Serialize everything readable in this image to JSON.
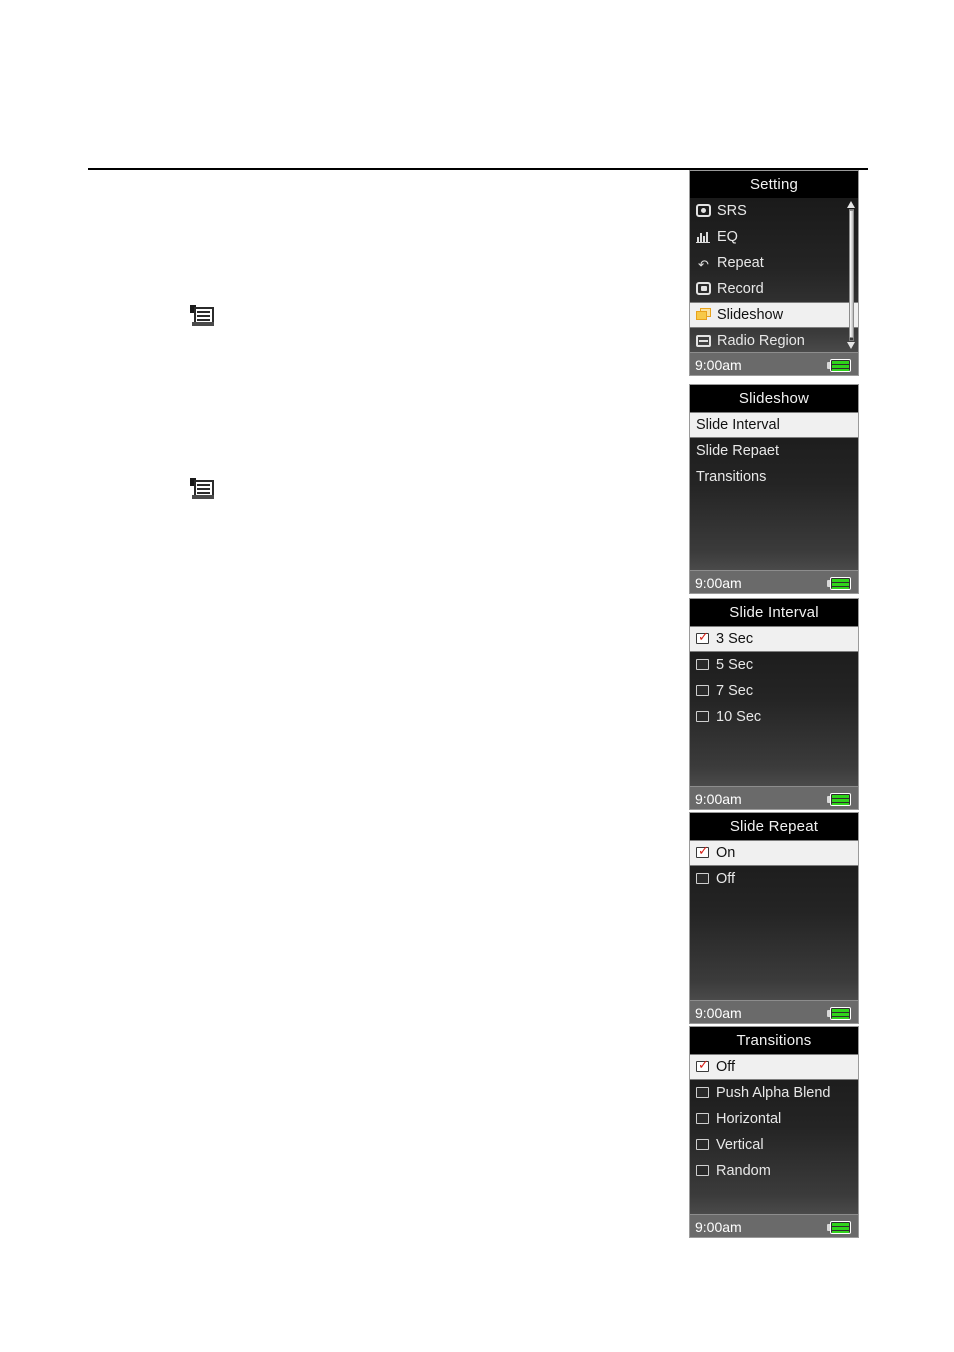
{
  "page": {
    "rule": "horizontal-rule",
    "inline_icons": [
      {
        "name": "menu-list-icon",
        "alt": "menu list icon"
      },
      {
        "name": "menu-list-icon",
        "alt": "menu list icon"
      }
    ]
  },
  "colors": {
    "title_bg": "#000000",
    "title_text": "#f2f2f2",
    "body_top": "#1a1a1a",
    "body_bottom": "#4a4a4a",
    "status_bg": "#6a6a6a",
    "selected_bg": "#f0f0f0",
    "selected_text": "#111111",
    "row_text": "#e8e8e8",
    "check_red": "#d81f15",
    "battery_green": "#2fd41a",
    "slideshow_orange": "#e8a21c"
  },
  "screens": [
    {
      "id": "setting",
      "title": "Setting",
      "scrollbar": true,
      "rows": [
        {
          "label": "SRS",
          "icon": "srs-icon",
          "selected": false,
          "type": "menu"
        },
        {
          "label": "EQ",
          "icon": "eq-icon",
          "selected": false,
          "type": "menu"
        },
        {
          "label": "Repeat",
          "icon": "repeat-icon",
          "selected": false,
          "type": "menu"
        },
        {
          "label": "Record",
          "icon": "record-icon",
          "selected": false,
          "type": "menu"
        },
        {
          "label": "Slideshow",
          "icon": "slideshow-icon",
          "selected": true,
          "type": "menu"
        },
        {
          "label": "Radio Region",
          "icon": "radio-region-icon",
          "selected": false,
          "type": "menu"
        }
      ],
      "status": {
        "time": "9:00am",
        "battery": "battery-full-icon"
      }
    },
    {
      "id": "slideshow",
      "title": "Slideshow",
      "scrollbar": false,
      "rows": [
        {
          "label": "Slide Interval",
          "selected": true,
          "type": "menu"
        },
        {
          "label": "Slide Repaet",
          "selected": false,
          "type": "menu"
        },
        {
          "label": "Transitions",
          "selected": false,
          "type": "menu"
        }
      ],
      "status": {
        "time": "9:00am",
        "battery": "battery-full-icon"
      }
    },
    {
      "id": "slide-interval",
      "title": "Slide Interval",
      "scrollbar": false,
      "rows": [
        {
          "label": "3 Sec",
          "selected": true,
          "type": "check",
          "checked": true
        },
        {
          "label": "5 Sec",
          "selected": false,
          "type": "check",
          "checked": false
        },
        {
          "label": "7 Sec",
          "selected": false,
          "type": "check",
          "checked": false
        },
        {
          "label": "10 Sec",
          "selected": false,
          "type": "check",
          "checked": false
        }
      ],
      "status": {
        "time": "9:00am",
        "battery": "battery-full-icon"
      }
    },
    {
      "id": "slide-repeat",
      "title": "Slide Repeat",
      "scrollbar": false,
      "rows": [
        {
          "label": "On",
          "selected": true,
          "type": "check",
          "checked": true
        },
        {
          "label": "Off",
          "selected": false,
          "type": "check",
          "checked": false
        }
      ],
      "status": {
        "time": "9:00am",
        "battery": "battery-full-icon"
      }
    },
    {
      "id": "transitions",
      "title": "Transitions",
      "scrollbar": false,
      "rows": [
        {
          "label": "Off",
          "selected": true,
          "type": "check",
          "checked": true
        },
        {
          "label": "Push Alpha Blend",
          "selected": false,
          "type": "check",
          "checked": false
        },
        {
          "label": "Horizontal",
          "selected": false,
          "type": "check",
          "checked": false
        },
        {
          "label": "Vertical",
          "selected": false,
          "type": "check",
          "checked": false
        },
        {
          "label": "Random",
          "selected": false,
          "type": "check",
          "checked": false
        }
      ],
      "status": {
        "time": "9:00am",
        "battery": "battery-full-icon"
      }
    }
  ]
}
